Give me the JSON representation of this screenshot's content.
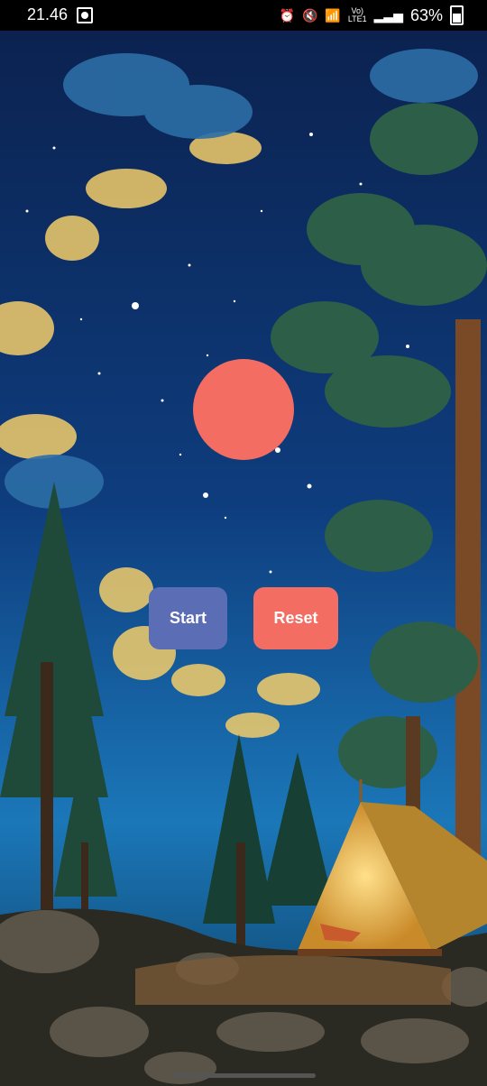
{
  "status": {
    "time": "21.46",
    "battery": "63%",
    "network_top": "Vo)",
    "network_bottom": "LTE1"
  },
  "controls": {
    "start_label": "Start",
    "reset_label": "Reset"
  }
}
